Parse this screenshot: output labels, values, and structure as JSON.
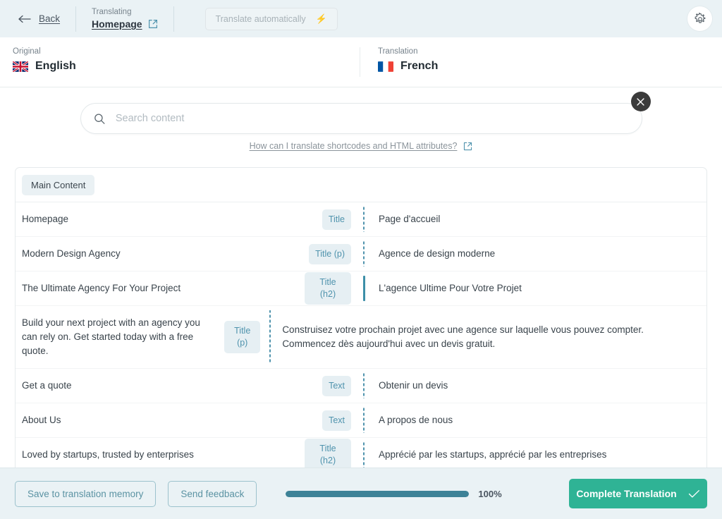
{
  "topbar": {
    "back_label": "Back",
    "translating_caption": "Translating",
    "page_name": "Homepage",
    "auto_translate_label": "Translate automatically",
    "bolt_icon": "lightning-bolt-icon",
    "gear_icon": "gear-icon",
    "external_link_icon": "external-link-icon"
  },
  "langbar": {
    "original_caption": "Original",
    "original_language": "English",
    "original_flag": "flag-uk",
    "translation_caption": "Translation",
    "translation_language": "French",
    "translation_flag": "flag-france"
  },
  "search": {
    "placeholder": "Search content",
    "value": "",
    "search_icon": "search-icon",
    "close_icon": "close-icon",
    "help_text": "How can I translate shortcodes and HTML attributes?",
    "help_link_icon": "external-link-icon"
  },
  "card": {
    "tab_label": "Main Content",
    "rows": [
      {
        "source": "Homepage",
        "badge": "Title",
        "target": "Page d'accueil",
        "active": false
      },
      {
        "source": "Modern Design Agency",
        "badge": "Title (p)",
        "target": "Agence de design moderne",
        "active": false
      },
      {
        "source": "The Ultimate Agency For Your Project",
        "badge": "Title (h2)",
        "target": "L'agence Ultime Pour Votre Projet",
        "active": true
      },
      {
        "source": "Build your next project with an agency you can rely on. Get started today with a free quote.",
        "badge": "Title (p)",
        "target": "Construisez votre prochain projet avec une agence sur laquelle vous pouvez compter. Commencez dès aujourd'hui avec un devis gratuit.",
        "active": false
      },
      {
        "source": "Get a quote",
        "badge": "Text",
        "target": "Obtenir un devis",
        "active": false
      },
      {
        "source": "About Us",
        "badge": "Text",
        "target": "A propos de nous",
        "active": false
      },
      {
        "source": "Loved by startups, trusted by enterprises",
        "badge": "Title (h2)",
        "target": "Apprécié par les startups, apprécié par les entreprises",
        "active": false
      }
    ]
  },
  "footer": {
    "save_memory_label": "Save to translation memory",
    "send_feedback_label": "Send feedback",
    "progress_percent_label": "100%",
    "progress_value": 100,
    "complete_label": "Complete Translation",
    "check_icon": "check-icon"
  },
  "colors": {
    "page_bg": "#ffffff",
    "bar_bg": "#eaf2f5",
    "accent_teal": "#4f93ad",
    "accent_dark_teal": "#3d8297",
    "primary_green": "#2fb395",
    "badge_bg": "#e6eff3",
    "text_primary": "#39434b",
    "text_muted": "#8b949b"
  }
}
